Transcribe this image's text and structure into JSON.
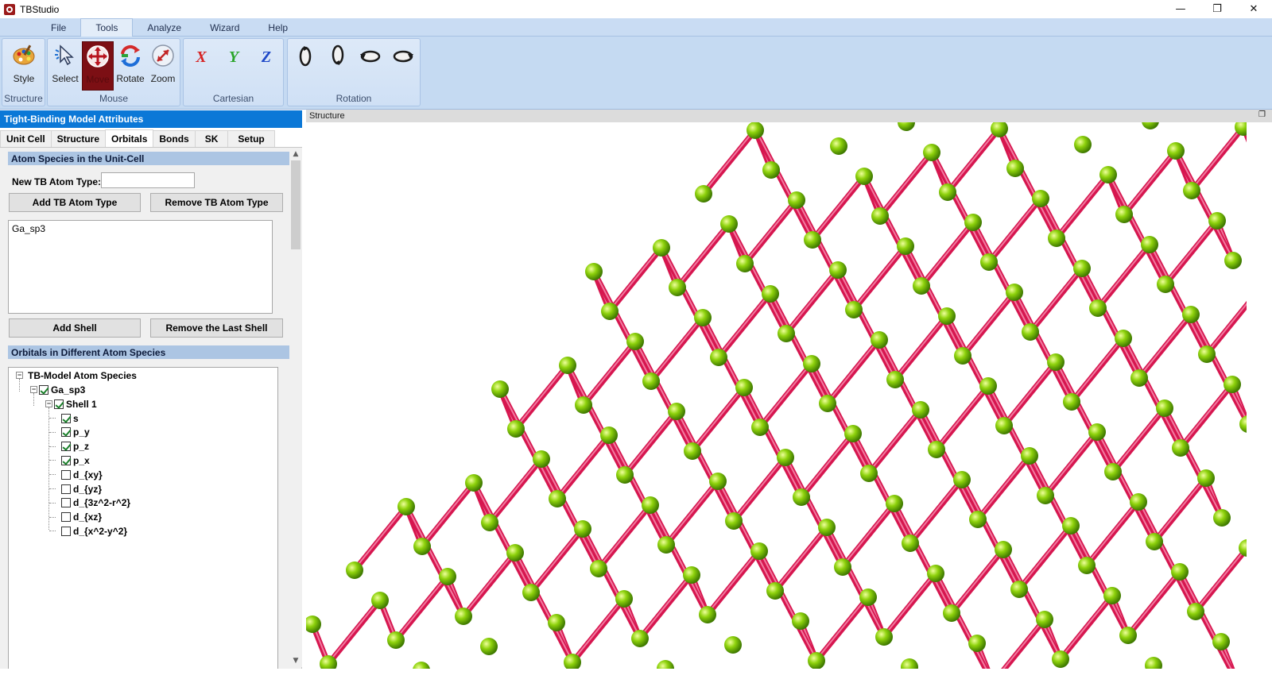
{
  "window": {
    "title": "TBStudio",
    "minimize": "—",
    "restore": "❐",
    "close": "✕"
  },
  "menu": {
    "tabs": [
      "File",
      "Tools",
      "Analyze",
      "Wizard",
      "Help"
    ],
    "active": "Tools"
  },
  "ribbon": {
    "groups": {
      "structure": {
        "label": "Structure",
        "tools": {
          "style": "Style"
        }
      },
      "mouse": {
        "label": "Mouse",
        "tools": {
          "select": "Select",
          "move": "Move",
          "rotate": "Rotate",
          "zoom": "Zoom"
        }
      },
      "cartesian": {
        "label": "Cartesian",
        "tools": {
          "x": "X",
          "y": "Y",
          "z": "Z"
        }
      },
      "rotation": {
        "label": "Rotation"
      }
    },
    "pressed_tool": "Move"
  },
  "left_panel": {
    "header": "Tight-Binding Model Attributes",
    "tabs": [
      "Unit Cell",
      "Structure",
      "Orbitals",
      "Bonds",
      "SK",
      "Setup"
    ],
    "active_tab": "Orbitals",
    "atom_species": {
      "section_title": "Atom Species in the Unit-Cell",
      "new_type_label": "New TB Atom Type:",
      "new_type_value": "",
      "add_button": "Add TB Atom Type",
      "remove_button": "Remove TB Atom Type",
      "list": [
        "Ga_sp3"
      ],
      "add_shell_button": "Add Shell",
      "remove_shell_button": "Remove the Last Shell"
    },
    "orbitals": {
      "section_title": "Orbitals in Different Atom Species",
      "root": "TB-Model Atom Species",
      "species": "Ga_sp3",
      "shell": "Shell 1",
      "items": [
        {
          "label": "s",
          "checked": true
        },
        {
          "label": "p_y",
          "checked": true
        },
        {
          "label": "p_z",
          "checked": true
        },
        {
          "label": "p_x",
          "checked": true
        },
        {
          "label": "d_{xy}",
          "checked": false
        },
        {
          "label": "d_{yz}",
          "checked": false
        },
        {
          "label": "d_{3z^2-r^2}",
          "checked": false
        },
        {
          "label": "d_{xz}",
          "checked": false
        },
        {
          "label": "d_{x^2-y^2}",
          "checked": false
        }
      ]
    }
  },
  "viewer": {
    "title": "Structure",
    "colors": {
      "bond": "#d6164f",
      "atom": "#8ed20c",
      "atom_highlight": "#e8ff9a"
    }
  }
}
